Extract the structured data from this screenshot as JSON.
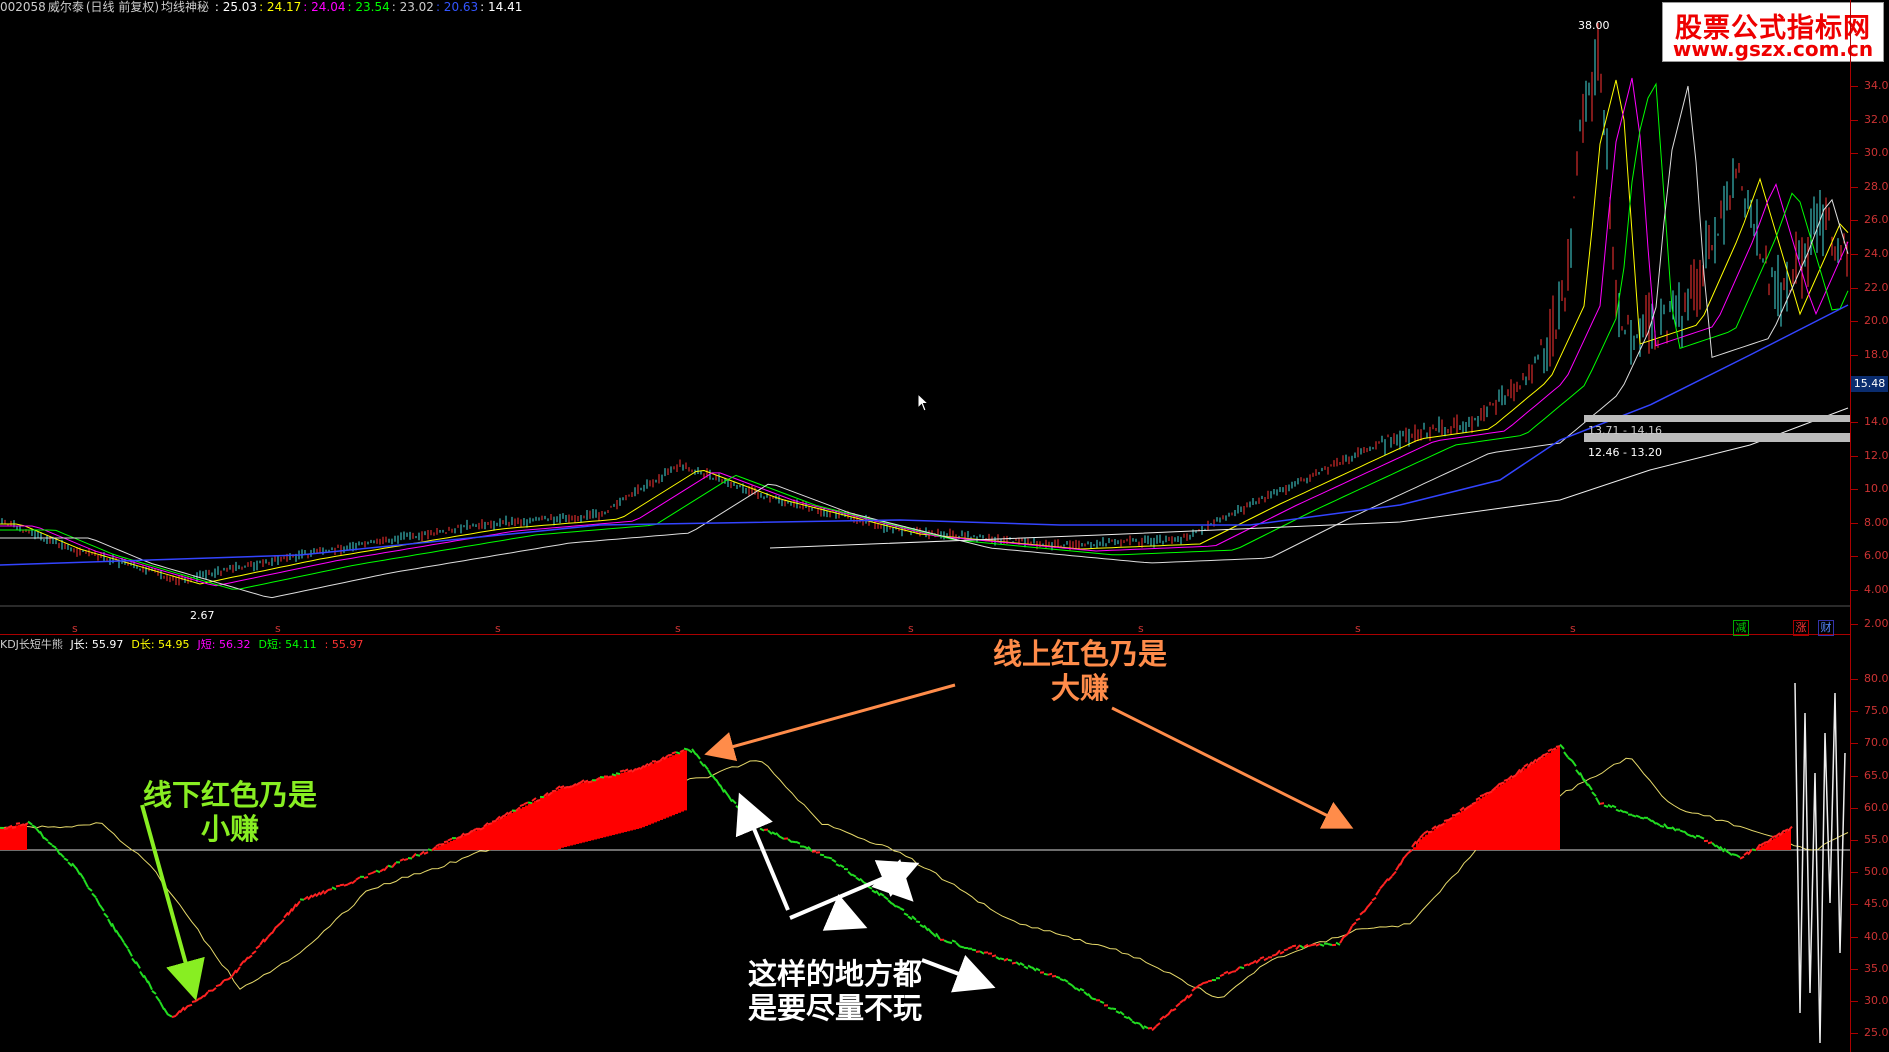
{
  "header": {
    "code": "002058",
    "name": "威尔泰",
    "period": "(日线 前复权)",
    "indicator": "均线神秘",
    "values": [
      {
        "text": "25.03",
        "color": "#ffffff"
      },
      {
        "text": "24.17",
        "color": "#ffff00"
      },
      {
        "text": "24.04",
        "color": "#ff00ff"
      },
      {
        "text": "23.54",
        "color": "#00ff00"
      },
      {
        "text": "23.02",
        "color": "#cccccc"
      },
      {
        "text": "20.63",
        "color": "#3355ff"
      },
      {
        "text": "14.41",
        "color": "#ffffff"
      }
    ]
  },
  "price_axis": {
    "ticks": [
      "34.00",
      "32.00",
      "30.00",
      "28.00",
      "26.00",
      "24.00",
      "22.00",
      "20.00",
      "18.00",
      "16.00",
      "14.00",
      "12.00",
      "10.00",
      "8.00",
      "6.00",
      "4.00",
      "2.00"
    ],
    "current_price": "15.48"
  },
  "annotations_main": {
    "high_label": "38.00",
    "low_label": "2.67",
    "zone1": "13.71 - 14.16",
    "zone2": "12.46 - 13.20"
  },
  "signal_labels": {
    "s": "s",
    "green": "减",
    "red": "涨",
    "blue": "财"
  },
  "sub_header": {
    "name": "KDJ长短牛熊",
    "items": [
      {
        "text": "J长: 55.97",
        "color": "#ffffff"
      },
      {
        "text": "D长: 54.95",
        "color": "#ffff00"
      },
      {
        "text": "J短: 56.32",
        "color": "#ff00ff"
      },
      {
        "text": "D短: 54.11",
        "color": "#00ff00"
      },
      {
        "text": ": 55.97",
        "color": "#ff3333"
      }
    ]
  },
  "sub_axis": {
    "ticks": [
      "80.00",
      "75.00",
      "70.00",
      "65.00",
      "60.00",
      "55.00",
      "50.00",
      "45.00",
      "40.00",
      "35.00",
      "30.00",
      "25.00"
    ]
  },
  "watermark": {
    "title": "股票公式指标网",
    "url": "www.gszx.com.cn"
  },
  "notes": {
    "above_line": [
      "线上红色乃是",
      "大赚"
    ],
    "below_line": [
      "线下红色乃是",
      "小赚"
    ],
    "avoid": [
      "这样的地方都",
      "是要尽量不玩"
    ]
  },
  "colors": {
    "axis": "#aa0000",
    "note_above": "#ff8c4a",
    "note_below": "#88ee22",
    "note_avoid": "#ffffff"
  }
}
